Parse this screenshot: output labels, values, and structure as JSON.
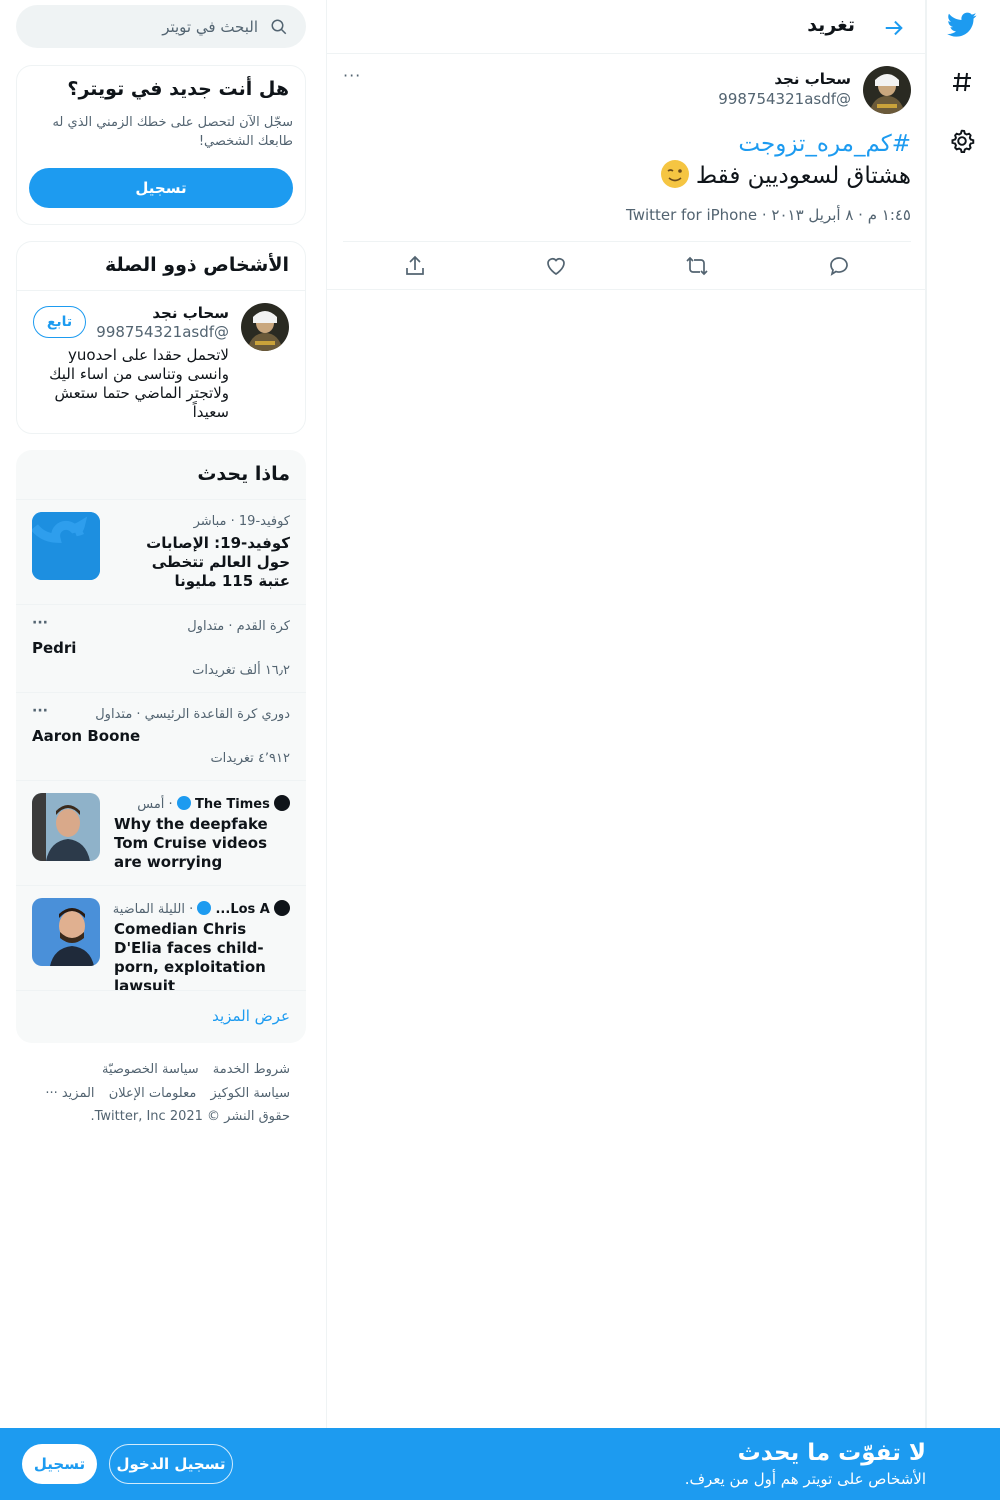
{
  "colors": {
    "accent": "#1d9bf0",
    "text": "#0f1419",
    "muted": "#536471",
    "trends_bg": "#f7f9f9"
  },
  "nav": {
    "icons": [
      "twitter-logo-icon",
      "hashtag-icon",
      "settings-gear-icon"
    ]
  },
  "header": {
    "title": "تغريد",
    "back_icon": "arrow-right-icon"
  },
  "tweet": {
    "author_name": "سحاب نجد",
    "author_handle": "@998754321asdf",
    "hashtag": "#كم_مره_تزوجت",
    "text": "هشتاق لسعوديين فقط",
    "emoji": "winking-face",
    "meta": "١:٤٥ م · ٨ أبريل ٢٠١٣ · Twitter for iPhone",
    "more": "···"
  },
  "search": {
    "placeholder": "البحث في تويتر"
  },
  "signup_card": {
    "title": "هل أنت جديد في تويتر؟",
    "description": "سجّل الآن لتحصل على خطك الزمني الذي له طابعك الشخصي!",
    "button": "تسجيل"
  },
  "related": {
    "title": "الأشخاص ذوو الصلة",
    "name": "سحاب نجد",
    "handle": "@998754321asdf",
    "follow": "تابع",
    "bio": "لاتحمل حقدا على احدyuo وانسى وتناسى من اساء اليك ولاتجتر الماضي حتما ستعش سعيداً"
  },
  "trends": {
    "title": "ماذا يحدث",
    "items": [
      {
        "meta": "كوفيد-19 · مباشر",
        "title": "كوفيد-19: الإصابات حول العالم تتخطى عتبة 115 مليونا"
      },
      {
        "meta": "كرة القدم · متداول",
        "title": "Pedri",
        "count": "١٦٫٢ ألف تغريدات",
        "more": "···"
      },
      {
        "meta": "دوري كرة القاعدة الرئيسي · متداول",
        "title": "Aaron Boone",
        "count": "٤٬٩١٢ تغريدات",
        "more": "···"
      },
      {
        "source": "The Times",
        "time": "· أمس",
        "title": "Why the deepfake Tom Cruise videos are worrying"
      },
      {
        "source": "Los A...",
        "time": "· الليلة الماضية",
        "title": "Comedian Chris D'Elia faces child-porn, exploitation lawsuit"
      }
    ],
    "show_more": "عرض المزيد"
  },
  "footer": {
    "terms": "شروط الخدمة",
    "privacy": "سياسة الخصوصيّة",
    "cookies": "سياسة الكوكيز",
    "ads": "معلومات الإعلان",
    "more": "المزيد ···",
    "copyright": "حقوق النشر © 2021 Twitter, Inc."
  },
  "bottom_bar": {
    "title": "لا تفوّت ما يحدث",
    "subtitle": "الأشخاص على تويتر هم أول من يعرف.",
    "login": "تسجيل الدخول",
    "register": "تسجيل"
  }
}
